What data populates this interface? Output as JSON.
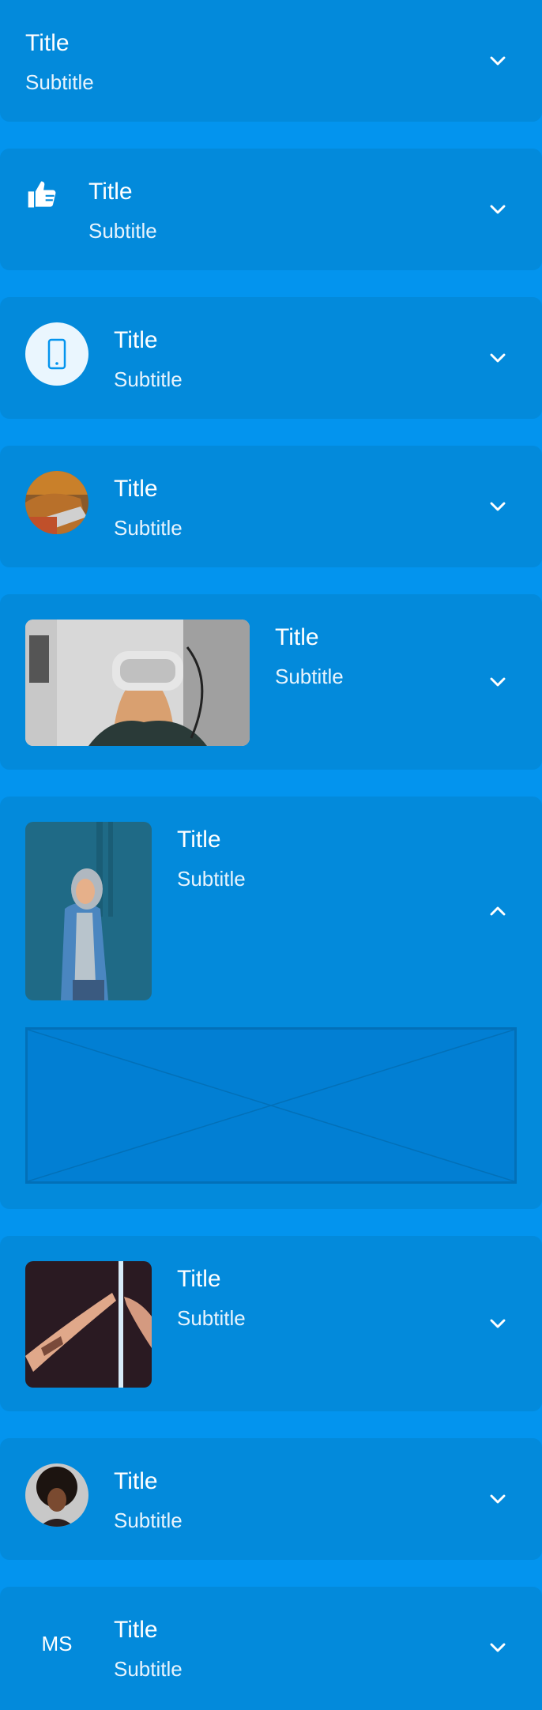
{
  "colors": {
    "background": "#0394ee",
    "card": "#038adb",
    "text": "#ffffff"
  },
  "items": [
    {
      "title": "Title",
      "subtitle": "Subtitle",
      "leading": "none",
      "chevron": "chevron-down-icon"
    },
    {
      "title": "Title",
      "subtitle": "Subtitle",
      "leading": "thumbs-up-icon",
      "chevron": "chevron-down-icon"
    },
    {
      "title": "Title",
      "subtitle": "Subtitle",
      "leading": "smartphone-icon",
      "chevron": "chevron-down-icon"
    },
    {
      "title": "Title",
      "subtitle": "Subtitle",
      "leading": "circle-photo",
      "chevron": "chevron-down-icon"
    },
    {
      "title": "Title",
      "subtitle": "Subtitle",
      "leading": "wide-photo-vr-headset",
      "chevron": "chevron-down-icon"
    },
    {
      "title": "Title",
      "subtitle": "Subtitle",
      "leading": "portrait-photo-person-hoodie",
      "chevron": "chevron-up-icon",
      "expanded": true
    },
    {
      "title": "Title",
      "subtitle": "Subtitle",
      "leading": "square-photo-hands",
      "chevron": "chevron-down-icon"
    },
    {
      "title": "Title",
      "subtitle": "Subtitle",
      "leading": "circle-avatar-photo",
      "chevron": "chevron-down-icon"
    },
    {
      "title": "Title",
      "subtitle": "Subtitle",
      "leading": "initials",
      "initials": "MS",
      "chevron": "chevron-down-icon"
    }
  ]
}
